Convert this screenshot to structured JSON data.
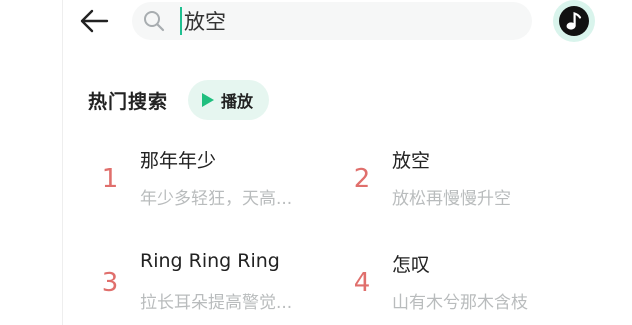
{
  "search": {
    "query": "放空",
    "placeholder": "放松再慢慢升空"
  },
  "hot_search": {
    "title": "热门搜索",
    "play_label": "播放",
    "items": [
      {
        "rank": "1",
        "title": "那年年少",
        "subtitle": "年少多轻狂，天高..."
      },
      {
        "rank": "2",
        "title": "放空",
        "subtitle": "放松再慢慢升空"
      },
      {
        "rank": "3",
        "title": "Ring Ring Ring",
        "subtitle": "拉长耳朵提高警觉..."
      },
      {
        "rank": "4",
        "title": "怎叹",
        "subtitle": "山有木兮那木含枝"
      }
    ]
  },
  "colors": {
    "accent": "#1fbf7e",
    "rank": "#e06f6c"
  },
  "icons": {
    "back": "arrow-left-icon",
    "search": "magnifier-icon",
    "player": "music-note-icon",
    "play": "play-triangle-icon"
  }
}
